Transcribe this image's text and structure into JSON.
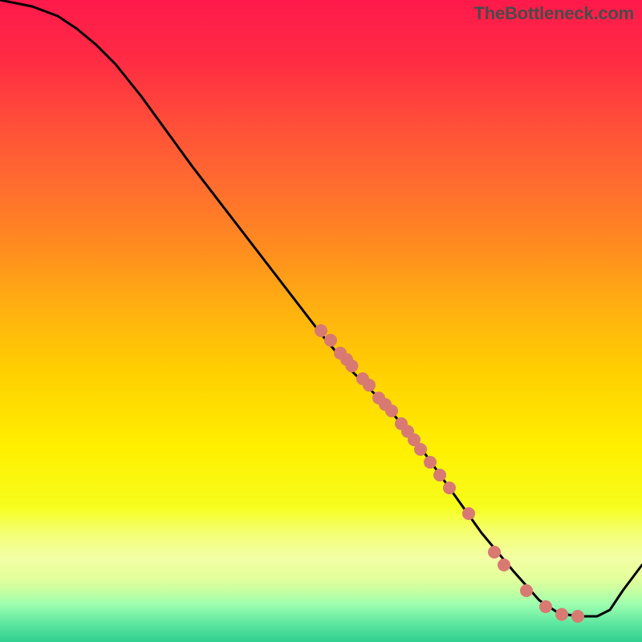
{
  "watermark": "TheBottleneck.com",
  "colors": {
    "curve": "#000000",
    "marker_fill": "#d87a72",
    "marker_stroke": "#b85a50"
  },
  "chart_data": {
    "type": "line",
    "title": "",
    "xlabel": "",
    "ylabel": "",
    "xlim": [
      0,
      100
    ],
    "ylim": [
      0,
      100
    ],
    "curve": [
      {
        "x": 0,
        "y": 100
      },
      {
        "x": 5,
        "y": 99
      },
      {
        "x": 9,
        "y": 97.5
      },
      {
        "x": 12,
        "y": 95.5
      },
      {
        "x": 15,
        "y": 93
      },
      {
        "x": 18,
        "y": 90
      },
      {
        "x": 22,
        "y": 85
      },
      {
        "x": 30,
        "y": 74
      },
      {
        "x": 40,
        "y": 61
      },
      {
        "x": 50,
        "y": 48
      },
      {
        "x": 55,
        "y": 42
      },
      {
        "x": 60,
        "y": 37
      },
      {
        "x": 65,
        "y": 31
      },
      {
        "x": 70,
        "y": 24
      },
      {
        "x": 75,
        "y": 17
      },
      {
        "x": 80,
        "y": 11
      },
      {
        "x": 84,
        "y": 6.5
      },
      {
        "x": 87,
        "y": 4.5
      },
      {
        "x": 90,
        "y": 4
      },
      {
        "x": 93,
        "y": 4
      },
      {
        "x": 95,
        "y": 5
      },
      {
        "x": 97,
        "y": 8
      },
      {
        "x": 100,
        "y": 12
      }
    ],
    "markers": [
      {
        "x": 50,
        "y": 48.5
      },
      {
        "x": 51.5,
        "y": 47
      },
      {
        "x": 53,
        "y": 45
      },
      {
        "x": 54,
        "y": 44
      },
      {
        "x": 54.8,
        "y": 43
      },
      {
        "x": 56.5,
        "y": 41
      },
      {
        "x": 57.5,
        "y": 40
      },
      {
        "x": 59,
        "y": 38
      },
      {
        "x": 60,
        "y": 37
      },
      {
        "x": 61,
        "y": 36
      },
      {
        "x": 62.5,
        "y": 34
      },
      {
        "x": 63.5,
        "y": 32.8
      },
      {
        "x": 64.5,
        "y": 31.5
      },
      {
        "x": 65.5,
        "y": 30
      },
      {
        "x": 67,
        "y": 28
      },
      {
        "x": 68.5,
        "y": 26
      },
      {
        "x": 70,
        "y": 24
      },
      {
        "x": 73,
        "y": 20
      },
      {
        "x": 77,
        "y": 14
      },
      {
        "x": 78.5,
        "y": 12
      },
      {
        "x": 82,
        "y": 8
      },
      {
        "x": 85,
        "y": 5.5
      },
      {
        "x": 87.5,
        "y": 4.3
      },
      {
        "x": 90,
        "y": 4
      }
    ],
    "marker_radius": 8
  }
}
